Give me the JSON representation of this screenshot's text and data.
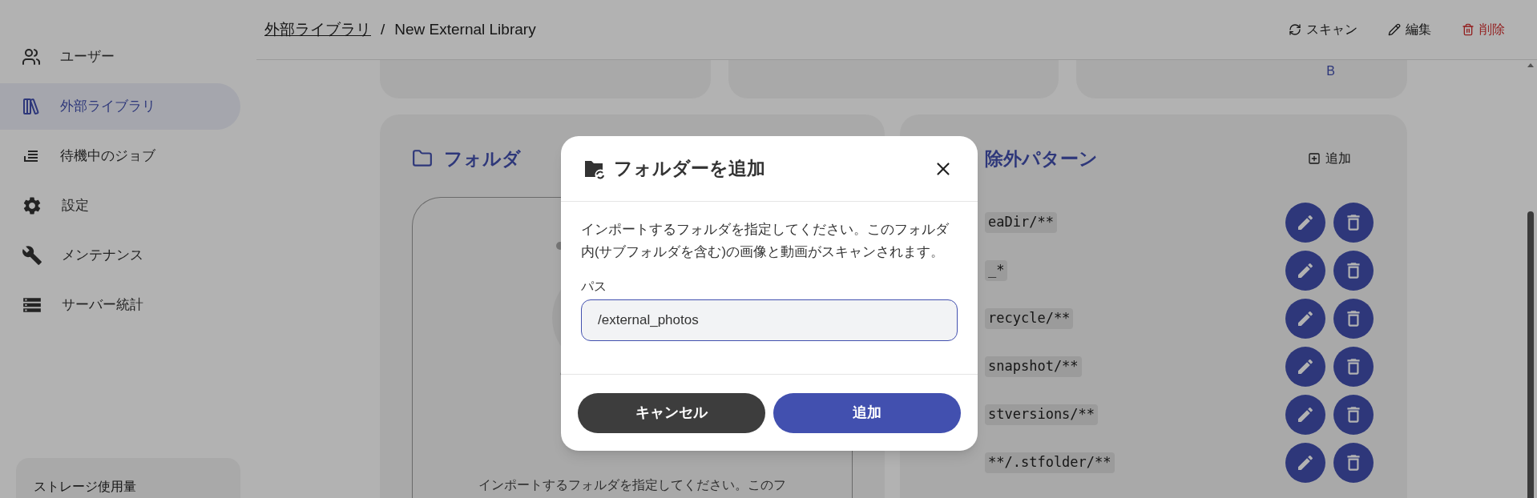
{
  "header": {
    "parent": "外部ライブラリ",
    "separator": "/",
    "title": "New External Library",
    "actions": [
      {
        "label": "スキャン",
        "kind": "scan"
      },
      {
        "label": "編集",
        "kind": "edit"
      },
      {
        "label": "削除",
        "kind": "delete"
      }
    ]
  },
  "sidebar": {
    "items": [
      {
        "label": "ユーザー",
        "kind": "users",
        "selected": false
      },
      {
        "label": "外部ライブラリ",
        "kind": "library",
        "selected": true
      },
      {
        "label": "待機中のジョブ",
        "kind": "jobs",
        "selected": false
      },
      {
        "label": "設定",
        "kind": "settings",
        "selected": false
      },
      {
        "label": "メンテナンス",
        "kind": "wrench",
        "selected": false
      },
      {
        "label": "サーバー統計",
        "kind": "server",
        "selected": false
      }
    ],
    "storage_title": "ストレージ使用量"
  },
  "stat_cards": [
    {
      "kind": "plain"
    },
    {
      "kind": "plain"
    },
    {
      "kind": "unit",
      "unit": "B"
    }
  ],
  "folders": {
    "title": "フォルダ",
    "empty_text": "インポートするフォルダを指定してください。このフ"
  },
  "exclusions": {
    "title": "除外パターン",
    "add_label": "追加",
    "patterns": [
      "eaDir/**",
      "_*",
      "recycle/**",
      "snapshot/**",
      "stversions/**",
      "**/.stfolder/**"
    ]
  },
  "dialog": {
    "title": "フォルダーを追加",
    "description": "インポートするフォルダを指定してください。このフォルダ内(サブフォルダを含む)の画像と動画がスキャンされます。",
    "field_label": "パス",
    "field_value": "/external_photos",
    "buttons": [
      {
        "label": "キャンセル",
        "kind": "secondary"
      },
      {
        "label": "追加",
        "kind": "primary"
      }
    ]
  }
}
